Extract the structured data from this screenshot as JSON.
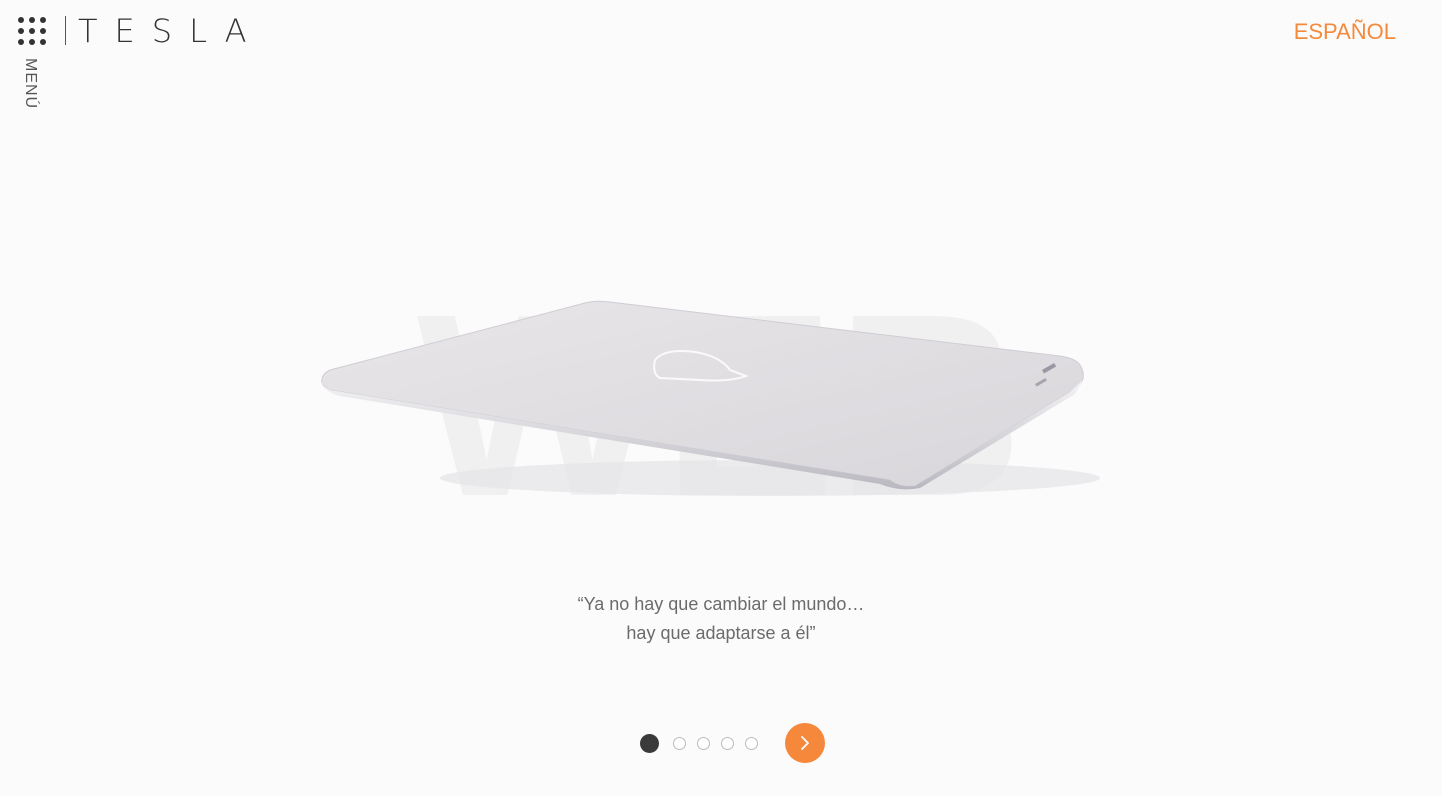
{
  "header": {
    "logo_text": "TESLA",
    "menu_label": "MENÚ",
    "language_label": "ESPAÑOL"
  },
  "hero": {
    "background_word": "WEB"
  },
  "quote": {
    "line1": "“Ya no hay que cambiar el mundo…",
    "line2": "hay que adaptarse a él”"
  },
  "pager": {
    "total_slides": 5,
    "active_index": 1
  },
  "colors": {
    "accent": "#f48a3c",
    "text": "#555555",
    "dark": "#333333",
    "background": "#fbfbfb"
  },
  "icons": {
    "apps": "grid-dots-icon",
    "next": "chevron-right-icon"
  }
}
